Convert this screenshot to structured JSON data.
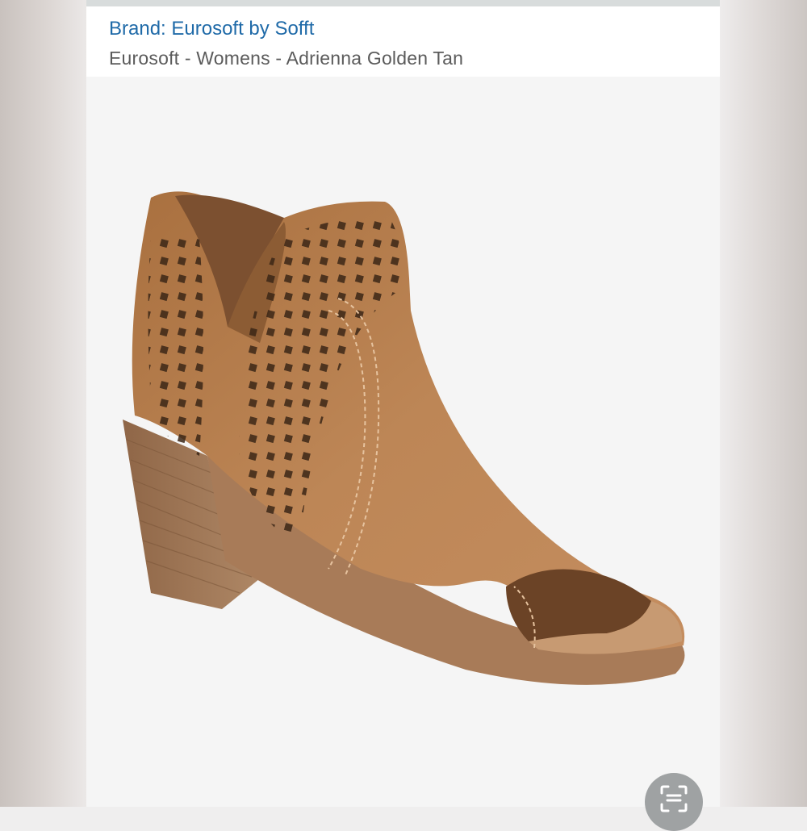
{
  "listing": {
    "brand_link": "Brand: Eurosoft by Sofft",
    "title": "Eurosoft - Womens - Adrienna Golden Tan"
  },
  "product_image": {
    "subject": "tan suede peep-toe ankle bootie with perforated pattern and stacked block heel",
    "colors": {
      "suede": "#b98151",
      "heel": "#a87b58",
      "background": "#f5f5f5"
    }
  },
  "controls": {
    "visual_search_icon": "lens-scan-icon"
  }
}
